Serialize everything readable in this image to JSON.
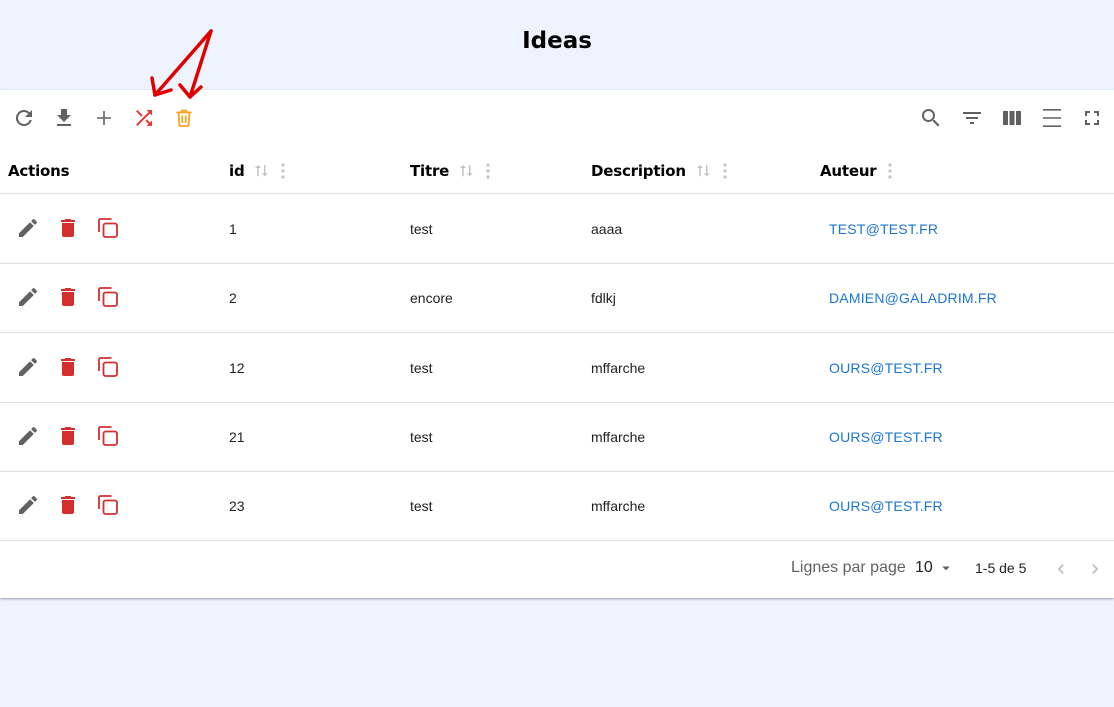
{
  "page": {
    "title": "Ideas"
  },
  "toolbar": {
    "left": [
      {
        "name": "refresh-icon"
      },
      {
        "name": "download-icon"
      },
      {
        "name": "add-icon"
      },
      {
        "name": "shuffle-icon",
        "color": "#e53935"
      },
      {
        "name": "trash-icon",
        "color": "#f5a623"
      }
    ],
    "right": [
      {
        "name": "search-icon"
      },
      {
        "name": "filter-icon"
      },
      {
        "name": "view-columns-icon"
      },
      {
        "name": "density-icon"
      },
      {
        "name": "fullscreen-icon"
      }
    ]
  },
  "table": {
    "columns": [
      {
        "label": "Actions"
      },
      {
        "label": "id"
      },
      {
        "label": "Titre"
      },
      {
        "label": "Description"
      },
      {
        "label": "Auteur"
      }
    ],
    "rows": [
      {
        "id": "1",
        "titre": "test",
        "description": "aaaa",
        "auteur": "TEST@TEST.FR"
      },
      {
        "id": "2",
        "titre": "encore",
        "description": "fdlkj",
        "auteur": "DAMIEN@GALADRIM.FR"
      },
      {
        "id": "12",
        "titre": "test",
        "description": "mffarche",
        "auteur": "OURS@TEST.FR"
      },
      {
        "id": "21",
        "titre": "test",
        "description": "mffarche",
        "auteur": "OURS@TEST.FR"
      },
      {
        "id": "23",
        "titre": "test",
        "description": "mffarche",
        "auteur": "OURS@TEST.FR"
      }
    ],
    "row_actions": [
      {
        "name": "edit-icon",
        "color": "#616161"
      },
      {
        "name": "delete-icon",
        "color": "#d32f2f"
      },
      {
        "name": "duplicate-icon",
        "color": "#d32f2f"
      }
    ]
  },
  "pagination": {
    "rows_per_page_label": "Lignes par page",
    "rows_per_page_value": "10",
    "range_label": "1-5 de 5"
  },
  "colors": {
    "link": "#1976d2",
    "annotation_arrow": "#e00000",
    "background": "#eef4fe"
  }
}
